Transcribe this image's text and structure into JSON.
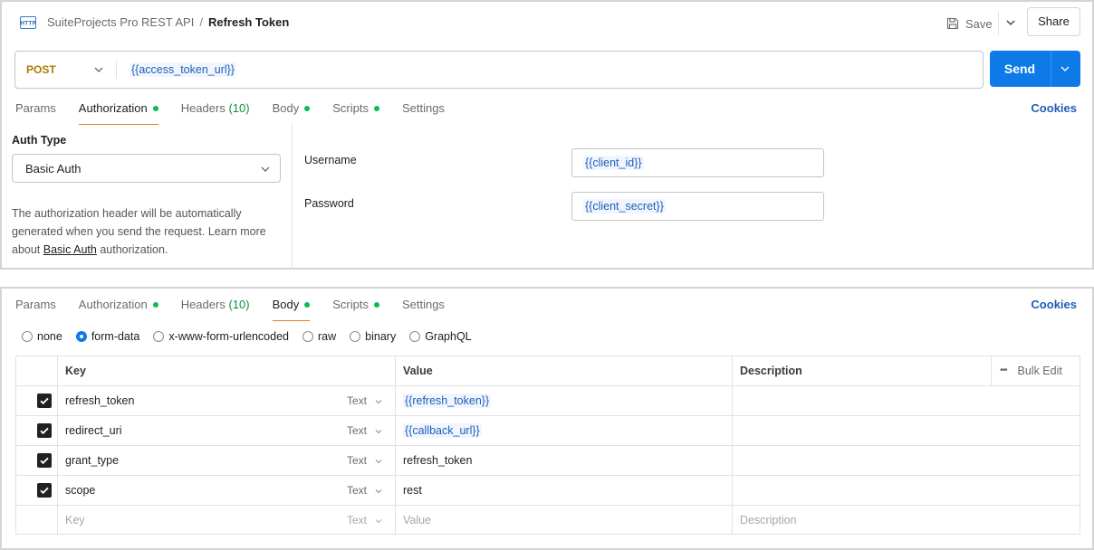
{
  "header": {
    "collection": "SuiteProjects Pro REST API",
    "separator": "/",
    "request_name": "Refresh Token",
    "save_label": "Save",
    "share_label": "Share"
  },
  "request": {
    "method": "POST",
    "url": "{{access_token_url}}",
    "send_label": "Send"
  },
  "tabs": [
    {
      "label": "Params"
    },
    {
      "label": "Authorization",
      "dot": true
    },
    {
      "label": "Headers",
      "count": "(10)"
    },
    {
      "label": "Body",
      "dot": true
    },
    {
      "label": "Scripts",
      "dot": true
    },
    {
      "label": "Settings"
    }
  ],
  "cookies_label": "Cookies",
  "auth": {
    "type_label": "Auth Type",
    "type_value": "Basic Auth",
    "desc_1": "The authorization header will be automatically generated when you send the request. Learn more about ",
    "desc_link": "Basic Auth",
    "desc_2": " authorization.",
    "username_label": "Username",
    "username_value": "{{client_id}}",
    "password_label": "Password",
    "password_value": "{{client_secret}}"
  },
  "body": {
    "modes": [
      "none",
      "form-data",
      "x-www-form-urlencoded",
      "raw",
      "binary",
      "GraphQL"
    ],
    "selected_mode": "form-data",
    "columns": {
      "key": "Key",
      "value": "Value",
      "description": "Description",
      "bulk_edit": "Bulk Edit"
    },
    "rows": [
      {
        "key": "refresh_token",
        "type": "Text",
        "value": "{{refresh_token}}",
        "is_var": true
      },
      {
        "key": "redirect_uri",
        "type": "Text",
        "value": "{{callback_url}}",
        "is_var": true
      },
      {
        "key": "grant_type",
        "type": "Text",
        "value": "refresh_token",
        "is_var": false
      },
      {
        "key": "scope",
        "type": "Text",
        "value": "rest",
        "is_var": false
      }
    ],
    "placeholder": {
      "key": "Key",
      "type": "Text",
      "value": "Value",
      "description": "Description"
    }
  },
  "colors": {
    "accent": "#0d7ae8",
    "method": "#ad7a03",
    "dot": "#0cbb52",
    "variable": "#1f5fb4"
  }
}
